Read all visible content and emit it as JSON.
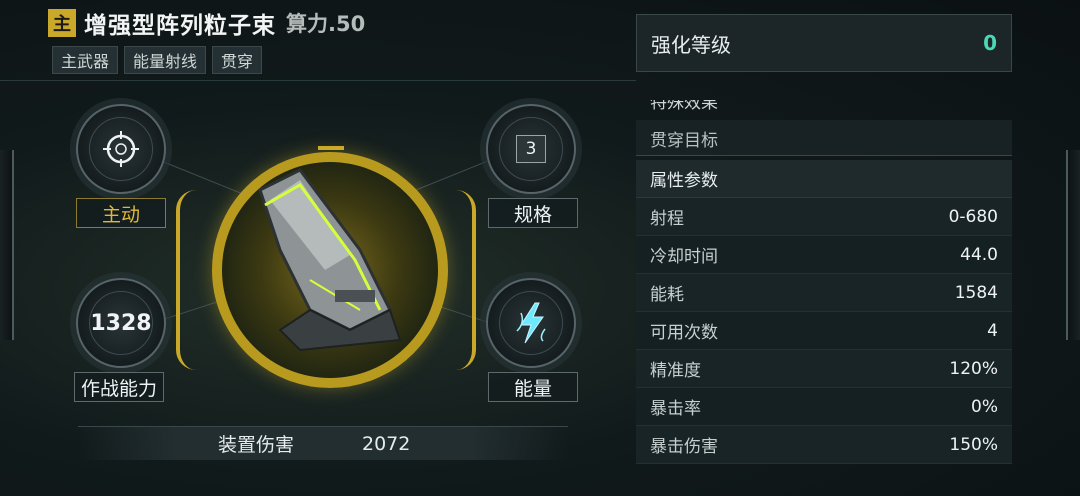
{
  "header": {
    "badge": "主",
    "weapon_name": "增强型阵列粒子束",
    "power": "算力.50"
  },
  "tags": [
    "主武器",
    "能量射线",
    "贯穿"
  ],
  "nodes": {
    "active": {
      "label": "主动",
      "icon": "crosshair-icon"
    },
    "spec": {
      "label": "规格",
      "value": "3"
    },
    "combat_power": {
      "label": "作战能力",
      "value": "1328"
    },
    "energy": {
      "label": "能量",
      "icon": "lightning-icon"
    }
  },
  "damage": {
    "label": "装置伤害",
    "value": "2072"
  },
  "enhancement": {
    "label": "强化等级",
    "value": "0"
  },
  "special_effect": {
    "title": "特殊效果",
    "row": "贯穿目标"
  },
  "attributes": {
    "title": "属性参数",
    "rows": [
      {
        "name": "射程",
        "value": "0-680"
      },
      {
        "name": "冷却时间",
        "value": "44.0"
      },
      {
        "name": "能耗",
        "value": "1584"
      },
      {
        "name": "可用次数",
        "value": "4"
      },
      {
        "name": "精准度",
        "value": "120%"
      },
      {
        "name": "暴击率",
        "value": "0%"
      },
      {
        "name": "暴击伤害",
        "value": "150%"
      }
    ]
  },
  "colors": {
    "gold": "#c9a82a",
    "enhance_value": "#4ad9b4",
    "active_label": "#e0b93a"
  }
}
